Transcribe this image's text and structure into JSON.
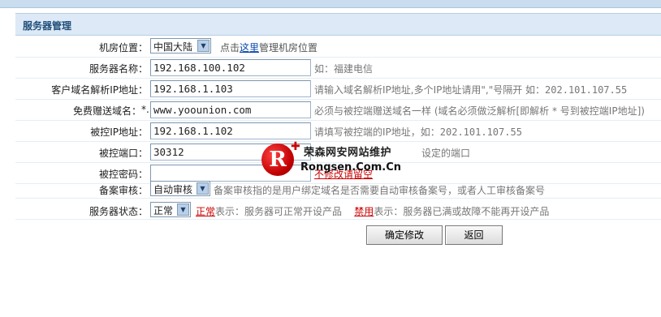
{
  "header": {
    "title": "服务器管理"
  },
  "room": {
    "label": "机房位置：",
    "selected": "中国大陆",
    "hint_prefix": "点击",
    "hint_link": "这里",
    "hint_suffix": "管理机房位置"
  },
  "server_name": {
    "label": "服务器名称：",
    "value": "192.168.100.102",
    "hint": "如：福建电信"
  },
  "dns_ip": {
    "label": "客户域名解析IP地址：",
    "value": "192.168.1.103",
    "hint": "请输入域名解析IP地址,多个IP地址请用\",\"号隔开 如：",
    "hint_ip": "202.101.107.55"
  },
  "gift_domain": {
    "label": "免费赠送域名：",
    "prefix": "*.",
    "value": "www.yoounion.com",
    "hint": "必须与被控端赠送域名一样 (域名必须做泛解析[即解析 * 号到被控端IP地址])"
  },
  "controlled_ip": {
    "label": "被控IP地址：",
    "value": "192.168.1.102",
    "hint": "请填写被控端的IP地址，如：",
    "hint_ip": "202.101.107.55"
  },
  "controlled_port": {
    "label": "被控端口：",
    "value": "30312",
    "hint": "设定的端口"
  },
  "controlled_password": {
    "label": "被控密码：",
    "value": "",
    "hint": "不修改请留空"
  },
  "filing": {
    "label": "备案审核：",
    "selected": "自动审核",
    "hint": "备案审核指的是用户绑定域名是否需要自动审核备案号，或者人工审核备案号"
  },
  "status": {
    "label": "服务器状态：",
    "selected": "正常",
    "normal_word": "正常",
    "normal_desc": "表示：服务器可正常开设产品",
    "disabled_word": "禁用",
    "disabled_desc": "表示：服务器已满或故障不能再开设产品"
  },
  "buttons": {
    "confirm": "确定修改",
    "back": "返回"
  },
  "watermark": {
    "logo_letter": "R",
    "cn": "荣森网安网站维护",
    "en": "Rongsen.Com.Cn"
  },
  "colors": {
    "header_bg": "#dde9f6",
    "title": "#1f4e79",
    "link_red": "#cc0000"
  }
}
